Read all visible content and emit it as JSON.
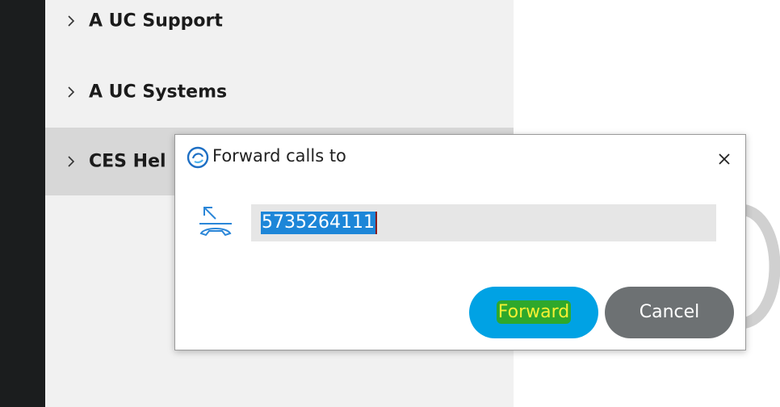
{
  "sidebar": {
    "groups": [
      {
        "label": "A UC Support"
      },
      {
        "label": "A UC Systems"
      },
      {
        "label": "CES Hel"
      }
    ]
  },
  "dialog": {
    "title": "Forward calls to",
    "number": "5735264111",
    "forward_label": "Forward",
    "cancel_label": "Cancel",
    "icons": {
      "title": "app-logo-icon",
      "close": "close-icon",
      "field": "call-forward-icon"
    }
  },
  "colors": {
    "accent": "#00a2e4",
    "selection": "#1d86d8",
    "cancel": "#6d7173",
    "highlight_green": "#2ea82c",
    "highlight_yellow": "#f6f033"
  }
}
